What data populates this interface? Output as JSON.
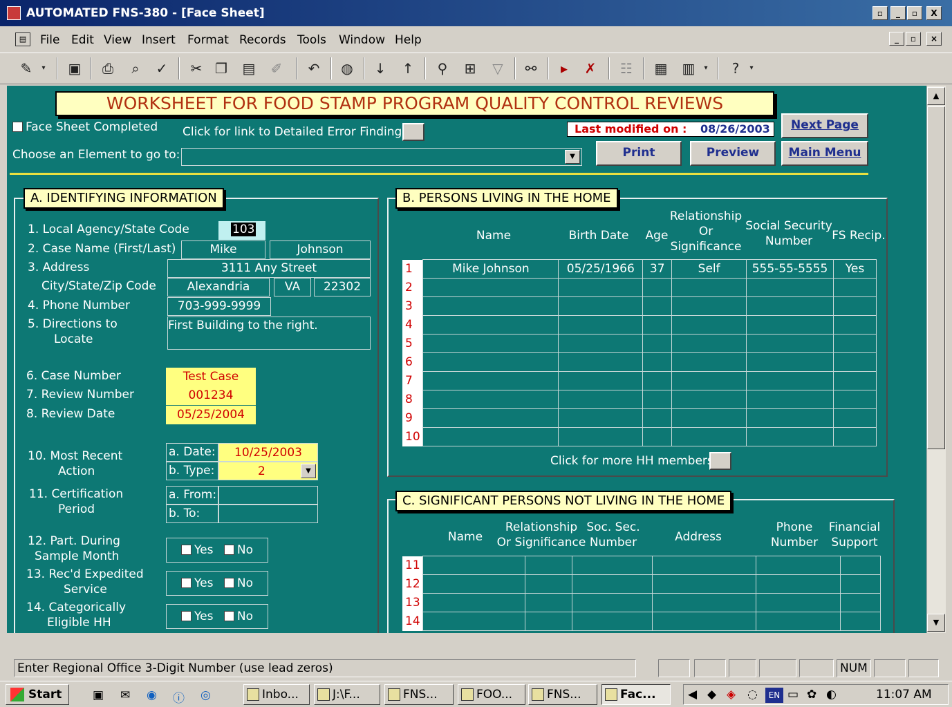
{
  "window": {
    "title": "AUTOMATED FNS-380 - [Face Sheet]",
    "controls": [
      "_",
      "▫",
      "X"
    ]
  },
  "menu": [
    "File",
    "Edit",
    "View",
    "Insert",
    "Format",
    "Records",
    "Tools",
    "Window",
    "Help"
  ],
  "form": {
    "heading": "WORKSHEET FOR FOOD STAMP PROGRAM QUALITY CONTROL REVIEWS",
    "face_sheet_completed": "Face Sheet Completed",
    "detailed_error_link": "Click for link to Detailed Error Findings:",
    "last_modified_label": "Last modified on :",
    "last_modified_date": "08/26/2003",
    "choose_element": "Choose an Element to go to:",
    "buttons": {
      "next_page": "Next Page",
      "print": "Print",
      "preview": "Preview",
      "main_menu": "Main Menu"
    }
  },
  "section_a": {
    "title": "A. IDENTIFYING INFORMATION",
    "labels": {
      "l1": "1. Local Agency/State Code",
      "l2": "2. Case Name (First/Last)",
      "l3": "3. Address",
      "l3b": "City/State/Zip Code",
      "l4": "4. Phone Number",
      "l5a": "5. Directions to",
      "l5b": "Locate",
      "l6": "6. Case Number",
      "l7": "7. Review Number",
      "l8": "8. Review Date",
      "l10a": "10. Most Recent",
      "l10b": "Action",
      "l11a": "11. Certification",
      "l11b": "Period",
      "l12a": "12. Part. During",
      "l12b": "Sample Month",
      "l13a": "13. Rec'd Expedited",
      "l13b": "Service",
      "l14a": "14. Categorically",
      "l14b": "Eligible HH"
    },
    "values": {
      "agency_code": "103",
      "first_name": "Mike",
      "last_name": "Johnson",
      "street": "3111 Any Street",
      "city": "Alexandria",
      "state": "VA",
      "zip": "22302",
      "phone": "703-999-9999",
      "directions": "First Building to the right.",
      "case_number": "Test Case",
      "review_number": "001234",
      "review_date": "05/25/2004",
      "action_date_label": "a. Date:",
      "action_date": "10/25/2003",
      "action_type_label": "b. Type:",
      "action_type": "2",
      "cert_from_label": "a. From:",
      "cert_to_label": "b. To:",
      "yes": "Yes",
      "no": "No"
    }
  },
  "section_b": {
    "title": "B. PERSONS LIVING IN THE HOME",
    "columns": {
      "name": "Name",
      "birth": "Birth Date",
      "age": "Age",
      "rel1": "Relationship",
      "rel2": "Or",
      "rel3": "Significance",
      "ssn1": "Social Security",
      "ssn2": "Number",
      "fs": "FS Recip."
    },
    "rows": [
      {
        "n": "1",
        "name": "Mike Johnson",
        "birth": "05/25/1966",
        "age": "37",
        "rel": "Self",
        "ssn": "555-55-5555",
        "fs": "Yes"
      },
      {
        "n": "2"
      },
      {
        "n": "3"
      },
      {
        "n": "4"
      },
      {
        "n": "5"
      },
      {
        "n": "6"
      },
      {
        "n": "7"
      },
      {
        "n": "8"
      },
      {
        "n": "9"
      },
      {
        "n": "10"
      }
    ],
    "more": "Click for more HH members:"
  },
  "section_c": {
    "title": "C. SIGNIFICANT PERSONS NOT LIVING IN THE HOME",
    "columns": {
      "name": "Name",
      "rel1": "Relationship",
      "rel2": "Or Significance",
      "ssn1": "Soc. Sec.",
      "ssn2": "Number",
      "addr": "Address",
      "ph1": "Phone",
      "ph2": "Number",
      "fin1": "Financial",
      "fin2": "Support"
    },
    "rows": [
      "11",
      "12",
      "13",
      "14"
    ]
  },
  "status": {
    "message": "Enter Regional Office 3-Digit Number (use lead zeros)",
    "num": "NUM"
  },
  "taskbar": {
    "start": "Start",
    "tasks": [
      "Inbo...",
      "J:\\F...",
      "FNS...",
      "FOO...",
      "FNS...",
      "Fac..."
    ],
    "tray_lang": "EN",
    "clock": "11:07 AM"
  }
}
